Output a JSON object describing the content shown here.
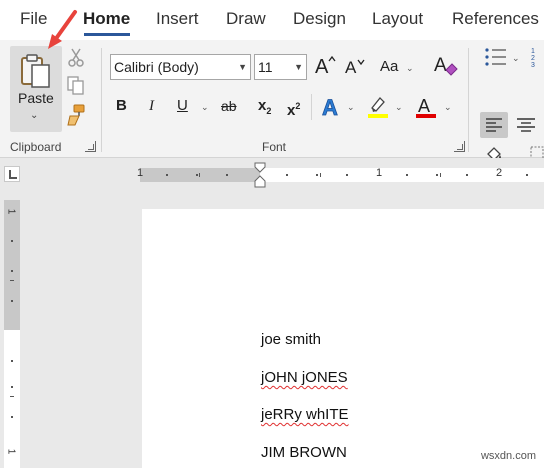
{
  "tabs": [
    "File",
    "Home",
    "Insert",
    "Draw",
    "Design",
    "Layout",
    "References"
  ],
  "active_tab": "Home",
  "clipboard": {
    "paste_label": "Paste",
    "group_label": "Clipboard"
  },
  "font": {
    "font_name": "Calibri (Body)",
    "font_size": "11",
    "change_case_label": "Aa",
    "bold": "B",
    "italic": "I",
    "underline": "U",
    "strikethrough": "ab",
    "subscript": "x",
    "subscript_mark": "2",
    "superscript": "x",
    "superscript_mark": "2",
    "text_effects": "A",
    "highlight_color": "#ffff00",
    "font_color_letter": "A",
    "font_color": "#e00000",
    "group_label": "Font"
  },
  "ruler": {
    "h_numbers": [
      "1",
      "1",
      "2"
    ],
    "v_numbers": [
      "1",
      "1"
    ]
  },
  "document": {
    "lines": [
      "joe smith",
      "jOHN jONES",
      "jeRRy whITE",
      "JIM BROWN"
    ]
  },
  "watermark": "wsxdn.com",
  "colors": {
    "accent": "#2b579a",
    "annotation_arrow": "#e8433c"
  }
}
